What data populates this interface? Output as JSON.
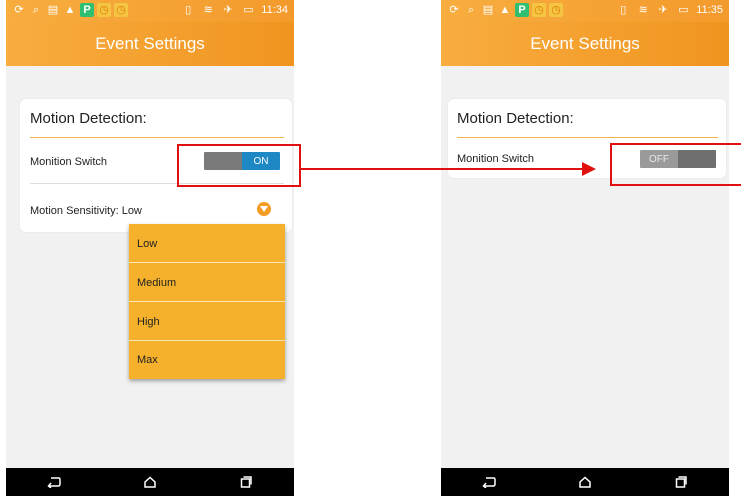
{
  "app": {
    "title": "Event Settings"
  },
  "left_screen": {
    "status_time": "11:34",
    "section_title": "Motion Detection:",
    "switch_label": "Monition Switch",
    "switch_state": "ON",
    "sensitivity_label": "Motion Sensitivity: Low",
    "dropdown_options": [
      "Low",
      "Medium",
      "High",
      "Max"
    ]
  },
  "right_screen": {
    "status_time": "11:35",
    "section_title": "Motion Detection:",
    "switch_label": "Monition Switch",
    "switch_state": "OFF"
  },
  "colors": {
    "accent_orange": "#f39a2c",
    "toggle_on_blue": "#1e88c4",
    "dropdown_bg": "#f6b12c",
    "annotation_red": "#e01010"
  },
  "icons": {
    "status_left": [
      "sync-icon",
      "search-icon",
      "message-icon",
      "alert-icon",
      "p-app-icon",
      "alarm-icon",
      "alarm-icon"
    ],
    "status_right": [
      "vibrate-icon",
      "wifi-icon",
      "airplane-icon",
      "battery-icon"
    ],
    "nav": [
      "back-icon",
      "home-icon",
      "recents-icon"
    ]
  }
}
